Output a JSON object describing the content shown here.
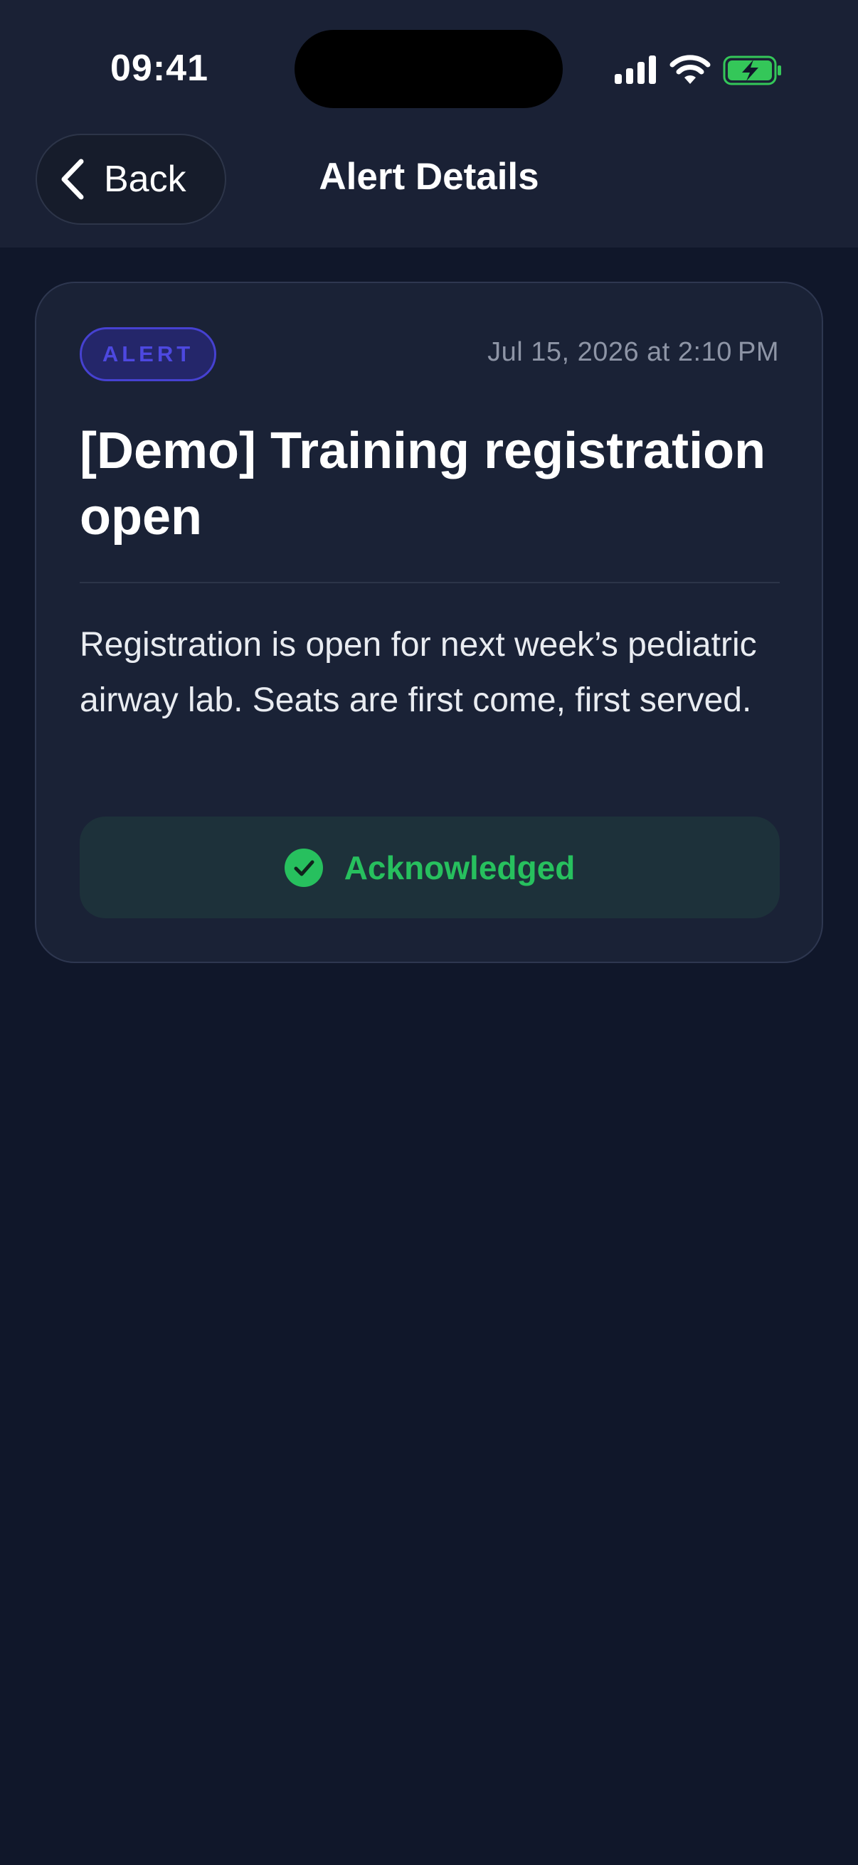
{
  "status_bar": {
    "time": "09:41"
  },
  "nav": {
    "back_label": "Back",
    "title": "Alert Details"
  },
  "alert": {
    "badge": "ALERT",
    "timestamp": "Jul 15, 2026 at 2:10 PM",
    "title": "[Demo] Training registration open",
    "body": "Registration is open for next week’s pediatric airway lab. Seats are first come, first served.",
    "status_label": "Acknowledged"
  },
  "colors": {
    "background": "#10172a",
    "card": "#1a2236",
    "badge_accent": "#4641d1",
    "acknowledged_green": "#27c05e",
    "battery_green": "#34c759"
  },
  "icons": {
    "back": "chevron-left-icon",
    "acknowledged": "check-circle-icon",
    "signal": "cellular-signal-icon",
    "wifi": "wifi-icon",
    "battery": "battery-charging-icon"
  }
}
